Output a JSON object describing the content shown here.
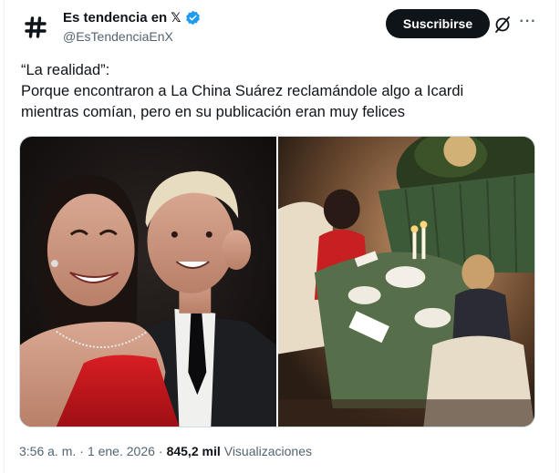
{
  "account": {
    "display_name": "Es tendencia en",
    "x_mark": "𝕏",
    "handle": "@EsTendenciaEnX",
    "verified": true,
    "avatar_icon": "hashtag-icon"
  },
  "actions": {
    "subscribe_label": "Suscribirse",
    "grok_icon": "grok-icon",
    "more_icon": "more-icon",
    "more_glyph": "···"
  },
  "tweet": {
    "lines": [
      "“La realidad”:",
      "Porque encontraron a La China Suárez reclamándole algo a Icardi",
      "mientras comían, pero en su publicación eran muy felices"
    ]
  },
  "media": {
    "photos": [
      "couple-selfie-photo",
      "restaurant-dinner-photo"
    ]
  },
  "footer": {
    "time": "3:56 a. m.",
    "separator": "·",
    "date": "1 ene. 2026",
    "separator2": "·",
    "views_count": "845,2 mil",
    "views_label": "Visualizaciones"
  },
  "colors": {
    "accent": "#1d9bf0",
    "text": "#0f1419",
    "muted": "#536471",
    "button": "#0f1419"
  }
}
